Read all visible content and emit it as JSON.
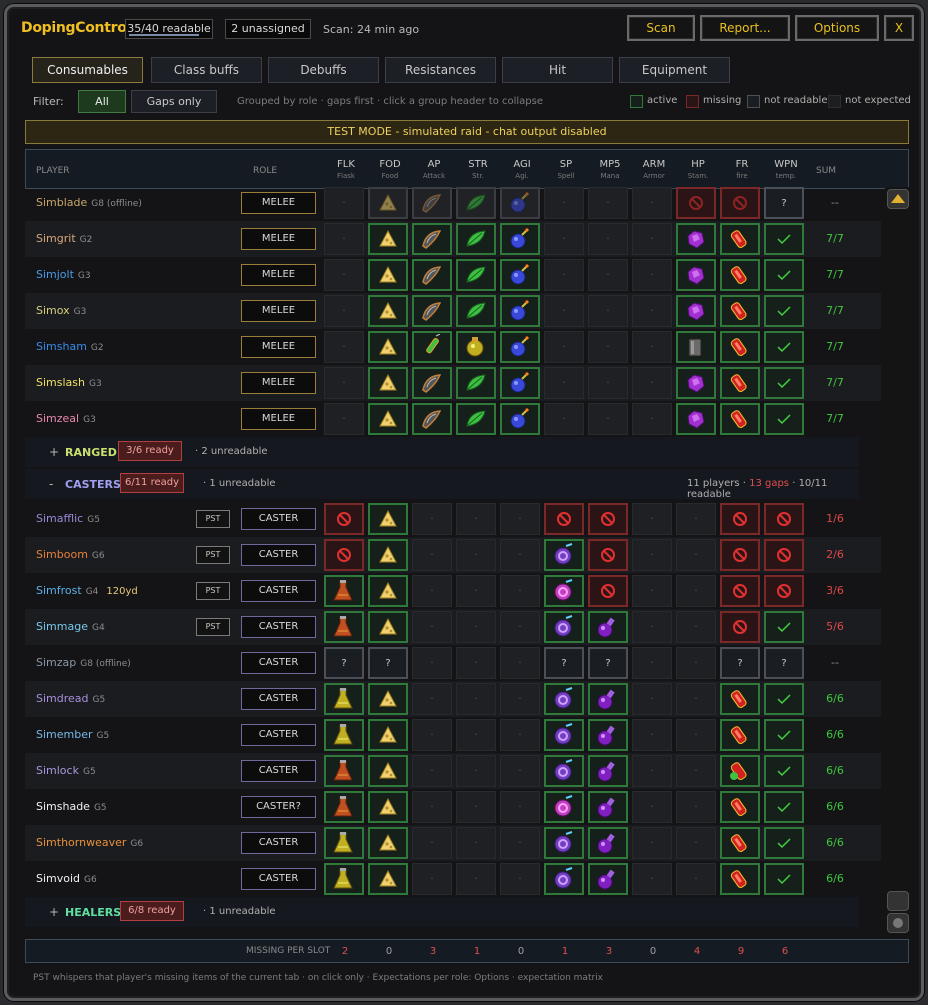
{
  "header": {
    "title": "DopingControl",
    "readable": "35/40 readable",
    "readable_fraction": 0.875,
    "unassigned": "2 unassigned",
    "scan_age": "Scan: 24 min ago",
    "buttons": {
      "scan": "Scan",
      "report": "Report...",
      "options": "Options",
      "close": "X"
    }
  },
  "tabs": [
    "Consumables",
    "Class buffs",
    "Debuffs",
    "Resistances",
    "Hit",
    "Equipment"
  ],
  "filter": {
    "label": "Filter:",
    "all": "All",
    "gaps_only": "Gaps only",
    "hint": "Grouped by role · gaps first · click a group header to collapse"
  },
  "legend": {
    "active": "active",
    "missing": "missing",
    "not_readable": "not readable",
    "not_expected": "not expected"
  },
  "banner": "TEST MODE - simulated raid - chat output disabled",
  "columns": {
    "player": "PLAYER",
    "role": "ROLE",
    "sum": "SUM",
    "slots": [
      {
        "code": "FLK",
        "sub": "Flask"
      },
      {
        "code": "FOD",
        "sub": "Food"
      },
      {
        "code": "AP",
        "sub": "Attack"
      },
      {
        "code": "STR",
        "sub": "Str."
      },
      {
        "code": "AGI",
        "sub": "Agi."
      },
      {
        "code": "SP",
        "sub": "Spell"
      },
      {
        "code": "MP5",
        "sub": "Mana"
      },
      {
        "code": "ARM",
        "sub": "Armor"
      },
      {
        "code": "HP",
        "sub": "Stam."
      },
      {
        "code": "FR",
        "sub": "fire"
      },
      {
        "code": "WPN",
        "sub": "temp."
      }
    ]
  },
  "melee_rows": [
    {
      "name": "Simblade",
      "group": "G8 (offline)",
      "color": "#c9a66a",
      "role": "MELEE",
      "sum": "--",
      "sumc": "d",
      "dim": true,
      "cells": [
        "-",
        "cheese",
        "blade",
        "leaf",
        "bomb",
        "-",
        "-",
        "-",
        "no",
        "no",
        "?"
      ]
    },
    {
      "name": "Simgrit",
      "group": "G2",
      "color": "#d8a878",
      "role": "MELEE",
      "sum": "7/7",
      "sumc": "g",
      "cells": [
        "-",
        "cheese",
        "blade",
        "leaf",
        "bomb",
        "-",
        "-",
        "-",
        "gem",
        "redvial",
        "check"
      ]
    },
    {
      "name": "Simjolt",
      "group": "G3",
      "color": "#4a9ae8",
      "role": "MELEE",
      "sum": "7/7",
      "sumc": "g",
      "cells": [
        "-",
        "cheese",
        "blade",
        "leaf",
        "bomb",
        "-",
        "-",
        "-",
        "gem",
        "redvial",
        "check"
      ]
    },
    {
      "name": "Simox",
      "group": "G3",
      "color": "#d8d078",
      "role": "MELEE",
      "sum": "7/7",
      "sumc": "g",
      "cells": [
        "-",
        "cheese",
        "blade",
        "leaf",
        "bomb",
        "-",
        "-",
        "-",
        "gem",
        "redvial",
        "check"
      ]
    },
    {
      "name": "Simsham",
      "group": "G2",
      "color": "#3a8ae8",
      "role": "MELEE",
      "sum": "7/7",
      "sumc": "g",
      "cells": [
        "-",
        "cheese",
        "syringe",
        "goldpot",
        "bomb",
        "-",
        "-",
        "-",
        "cup",
        "redvial",
        "check"
      ]
    },
    {
      "name": "Simslash",
      "group": "G3",
      "color": "#f0e060",
      "role": "MELEE",
      "sum": "7/7",
      "sumc": "g",
      "cells": [
        "-",
        "cheese",
        "blade",
        "leaf",
        "bomb",
        "-",
        "-",
        "-",
        "gem",
        "redvial",
        "check"
      ]
    },
    {
      "name": "Simzeal",
      "group": "G3",
      "color": "#e888b0",
      "role": "MELEE",
      "sum": "7/7",
      "sumc": "g",
      "cells": [
        "-",
        "cheese",
        "blade",
        "leaf",
        "bomb",
        "-",
        "-",
        "-",
        "gem",
        "redvial",
        "check"
      ]
    }
  ],
  "ranged_group": {
    "toggle": "+",
    "name": "RANGED",
    "ready": "3/6 ready",
    "extra": "· 2 unreadable"
  },
  "casters_group": {
    "toggle": "-",
    "name": "CASTERS",
    "ready": "6/11 ready",
    "extra": "· 1 unreadable",
    "summary_players": "11 players ·",
    "summary_gaps": "13 gaps",
    "summary_readable": "· 10/11 readable"
  },
  "caster_rows": [
    {
      "name": "Simafflic",
      "group": "G5",
      "color": "#9a88d8",
      "pst": "PST",
      "role": "CASTER",
      "sum": "1/6",
      "sumc": "r",
      "cells": [
        "no",
        "cheese",
        "-",
        "-",
        "-",
        "no",
        "no",
        "-",
        "-",
        "no",
        "no"
      ]
    },
    {
      "name": "Simboom",
      "group": "G6",
      "color": "#e8803a",
      "pst": "PST",
      "role": "CASTER",
      "sum": "2/6",
      "sumc": "r",
      "cells": [
        "no",
        "cheese",
        "-",
        "-",
        "-",
        "swirl",
        "no",
        "-",
        "-",
        "no",
        "no"
      ]
    },
    {
      "name": "Simfrost",
      "group": "G4",
      "range": "120yd",
      "color": "#5ab0e8",
      "pst": "PST",
      "role": "CASTER",
      "sum": "3/6",
      "sumc": "r",
      "cells": [
        "flaskred",
        "cheese",
        "-",
        "-",
        "-",
        "pinkswirl",
        "no",
        "-",
        "-",
        "no",
        "no"
      ]
    },
    {
      "name": "Simmage",
      "group": "G4",
      "color": "#78c8e8",
      "pst": "PST",
      "role": "CASTER",
      "sum": "5/6",
      "sumc": "r",
      "cells": [
        "flaskred",
        "cheese",
        "-",
        "-",
        "-",
        "swirl",
        "purplepot",
        "-",
        "-",
        "no",
        "check"
      ]
    },
    {
      "name": "Simzap",
      "group": "G8 (offline)",
      "color": "#8a98a8",
      "role": "CASTER",
      "sum": "--",
      "sumc": "d",
      "dim": true,
      "cells": [
        "?",
        "?",
        "-",
        "-",
        "-",
        "?",
        "?",
        "-",
        "-",
        "?",
        "?"
      ]
    },
    {
      "name": "Simdread",
      "group": "G5",
      "color": "#a890d8",
      "role": "CASTER",
      "sum": "6/6",
      "sumc": "g",
      "cells": [
        "flaskyel",
        "cheese",
        "-",
        "-",
        "-",
        "swirl",
        "purplepot",
        "-",
        "-",
        "redvial",
        "check"
      ]
    },
    {
      "name": "Simember",
      "group": "G5",
      "color": "#78b8e8",
      "role": "CASTER",
      "sum": "6/6",
      "sumc": "g",
      "cells": [
        "flaskyel",
        "cheese",
        "-",
        "-",
        "-",
        "swirl",
        "purplepot",
        "-",
        "-",
        "redvial",
        "check"
      ]
    },
    {
      "name": "Simlock",
      "group": "G5",
      "color": "#a898d8",
      "role": "CASTER",
      "sum": "6/6",
      "sumc": "g",
      "cells": [
        "flaskred",
        "cheese",
        "-",
        "-",
        "-",
        "swirl",
        "purplepot",
        "-",
        "-",
        "redgreen",
        "check"
      ]
    },
    {
      "name": "Simshade",
      "group": "G5",
      "color": "#f0f0f0",
      "role": "CASTER?",
      "sum": "6/6",
      "sumc": "g",
      "cells": [
        "flaskred",
        "cheese",
        "-",
        "-",
        "-",
        "pinkswirl",
        "purplepot",
        "-",
        "-",
        "redvial",
        "check"
      ]
    },
    {
      "name": "Simthornweaver",
      "group": "G6",
      "color": "#e8903a",
      "role": "CASTER",
      "sum": "6/6",
      "sumc": "g",
      "cells": [
        "flaskyel",
        "cheese",
        "-",
        "-",
        "-",
        "swirl",
        "purplepot",
        "-",
        "-",
        "redvial",
        "check"
      ]
    },
    {
      "name": "Simvoid",
      "group": "G6",
      "color": "#f0f0f0",
      "role": "CASTER",
      "sum": "6/6",
      "sumc": "g",
      "cells": [
        "flaskyel",
        "cheese",
        "-",
        "-",
        "-",
        "swirl",
        "purplepot",
        "-",
        "-",
        "redvial",
        "check"
      ]
    }
  ],
  "healers_group": {
    "toggle": "+",
    "name": "HEALERS",
    "ready": "6/8 ready",
    "extra": "· 1 unreadable"
  },
  "totals": {
    "label": "MISSING PER SLOT",
    "values": [
      "2",
      "0",
      "3",
      "1",
      "0",
      "1",
      "3",
      "0",
      "4",
      "9",
      "6"
    ]
  },
  "footer": "PST whispers that player's missing items of the current tab · on click only · Expectations per role: Options · expectation matrix",
  "colors": {
    "accent": "#f0c020",
    "active": "#2f7a3a",
    "missing": "#7a2828",
    "not_readable": "#4a4f58"
  }
}
